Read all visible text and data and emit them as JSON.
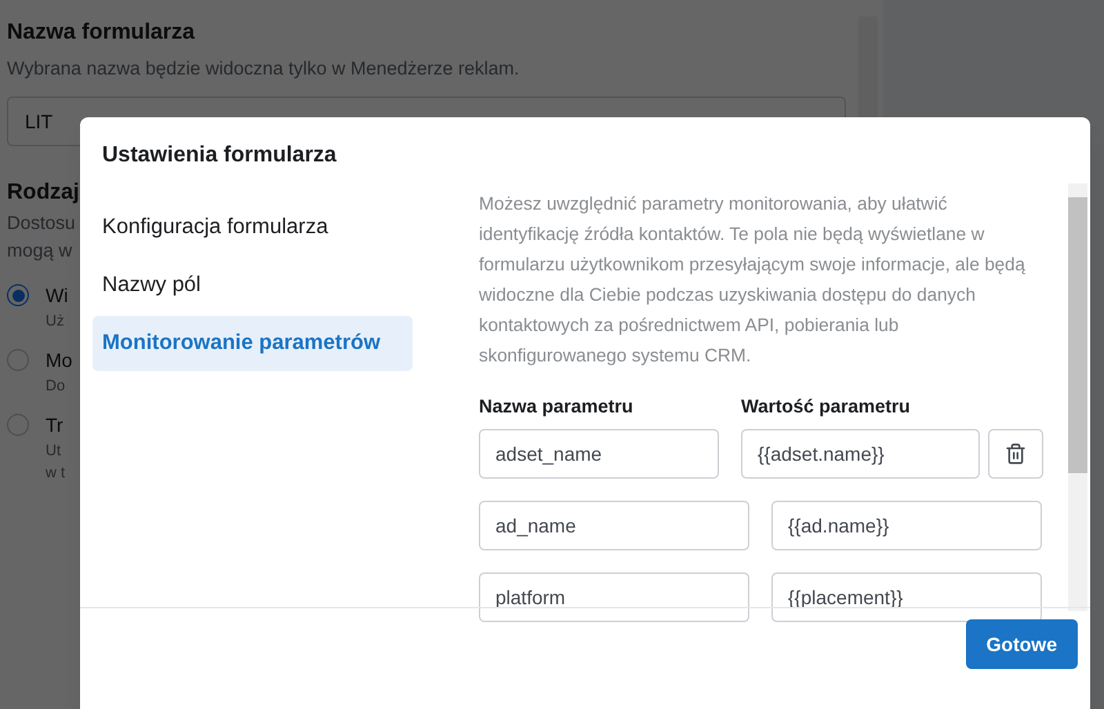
{
  "background": {
    "title": "Nazwa formularza",
    "subtitle": "Wybrana nazwa będzie widoczna tylko w Menedżerze reklam.",
    "form_name_value": "LIT",
    "section_title": "Rodzaj",
    "section_desc_lines": [
      "Dostosu",
      "mogą w"
    ],
    "options": [
      {
        "label": "Wi",
        "desc_lines": [
          "Uż"
        ],
        "selected": true
      },
      {
        "label": "Mo",
        "desc_lines": [
          "Do"
        ],
        "selected": false
      },
      {
        "label": "Tr",
        "desc_lines": [
          "Ut",
          "w t"
        ],
        "selected": false
      }
    ]
  },
  "modal": {
    "title": "Ustawienia formularza",
    "nav": [
      {
        "label": "Konfiguracja formularza",
        "selected": false
      },
      {
        "label": "Nazwy pól",
        "selected": false
      },
      {
        "label": "Monitorowanie parametrów",
        "selected": true
      }
    ],
    "description": "Możesz uwzględnić parametry monitorowania, aby ułatwić identyfikację źródła kontaktów. Te pola nie będą wyświetlane w formularzu użytkownikom przesyłającym swoje informacje, ale będą widoczne dla Ciebie podczas uzyskiwania dostępu do danych kontaktowych za pośrednictwem API, pobierania lub skonfigurowanego systemu CRM.",
    "columns": [
      "Nazwa parametru",
      "Wartość parametru"
    ],
    "params": [
      {
        "name": "adset_name",
        "value": "{{adset.name}}",
        "deletable": true
      },
      {
        "name": "ad_name",
        "value": "{{ad.name}}",
        "deletable": false
      },
      {
        "name": "platform",
        "value": "{{placement}}",
        "deletable": false
      }
    ],
    "done_button": "Gotowe"
  }
}
